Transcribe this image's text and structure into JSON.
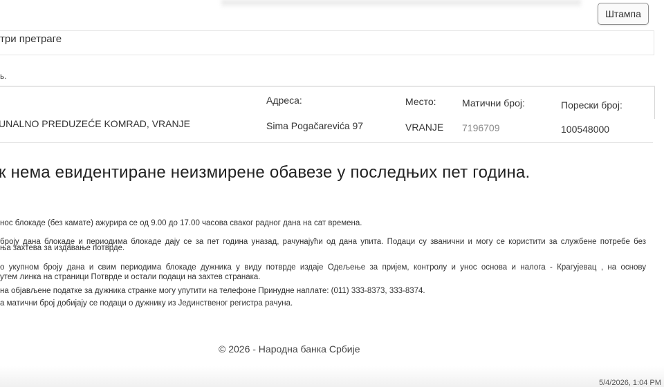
{
  "toolbar": {
    "print_label": "Штампа"
  },
  "search_params": {
    "title": "три претраге",
    "small_label": "ь."
  },
  "debtor": {
    "headers": {
      "address": "Адреса:",
      "place": "Место:",
      "reg_number": "Матични број:",
      "tax_number": "Порески број:"
    },
    "name": "UNALNO PREDUZEĆE KOMRAD, VRANJE",
    "address": "Sima Pogačarevića 97",
    "place": "VRANJE",
    "reg_number": "7196709",
    "tax_number": "100548000"
  },
  "message": "к нема евидентиране неизмирене обавезе у последњих пет година.",
  "notes": [
    "нос блокаде (без камате) ажурира се од 9.00 до 17.00 часова сваког радног дана на сат времена.",
    "броју дана блокаде и периодима блокаде дају се за пет година уназад, рачунајући од дана упита. Подаци су званични и могу се користити за службене потребе без",
    "ња захтева за издавање потврде.",
    "о укупном броју дана и свим периодима блокаде дужника у виду потврде издаје Одељење за пријем, контролу и унос основа и налога - Крагујевац , на основу",
    "утем линка на страници Потврде и остали подаци на захтев странака.",
    "на објављене податке за дужника странке могу упутити на телефоне Принудне наплате: (011) 333-8373, 333-8374.",
    "а матични број добијају се подаци о дужнику из Јединственог регистра рачуна."
  ],
  "footer": "© 2026 - Народна банка Србије",
  "timestamp": "5/4/2026, 1:04 PM"
}
